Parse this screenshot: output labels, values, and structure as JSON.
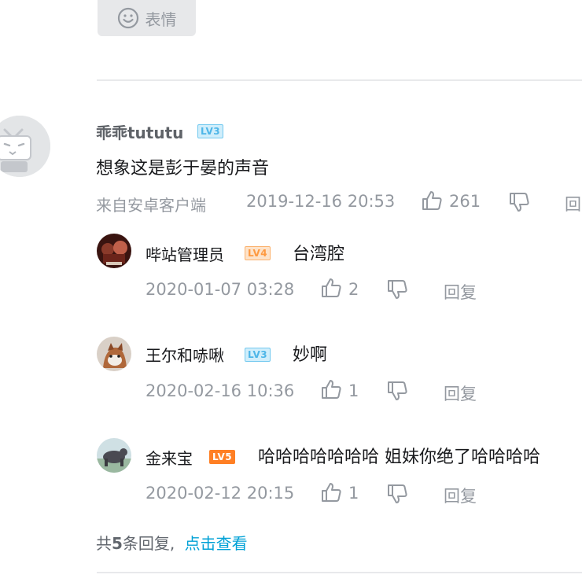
{
  "composer": {
    "emoji_label": "表情"
  },
  "main_comment": {
    "username": "乖乖tututu",
    "level": "LV3",
    "text": "想象这是彭于晏的声音",
    "device": "来自安卓客户端",
    "time": "2019-12-16 20:53",
    "likes": "261",
    "reply_label": "回"
  },
  "replies": [
    {
      "username": "哔站管理员",
      "level": "LV4",
      "text": "台湾腔",
      "time": "2020-01-07 03:28",
      "likes": "2",
      "reply_label": "回复"
    },
    {
      "username": "王尔和哧啾",
      "level": "LV3",
      "text": "妙啊",
      "time": "2020-02-16 10:36",
      "likes": "1",
      "reply_label": "回复"
    },
    {
      "username": "金来宝",
      "level": "LV5",
      "text": "哈哈哈哈哈哈哈 姐妹你绝了哈哈哈哈",
      "time": "2020-02-12 20:15",
      "likes": "1",
      "reply_label": "回复"
    }
  ],
  "reply_summary": {
    "prefix": "共",
    "count": "5",
    "suffix": "条回复,",
    "view_link": "点击查看"
  },
  "colors": {
    "link": "#00a1d6",
    "meta": "#9499a0",
    "divider": "#e8e9eb"
  }
}
